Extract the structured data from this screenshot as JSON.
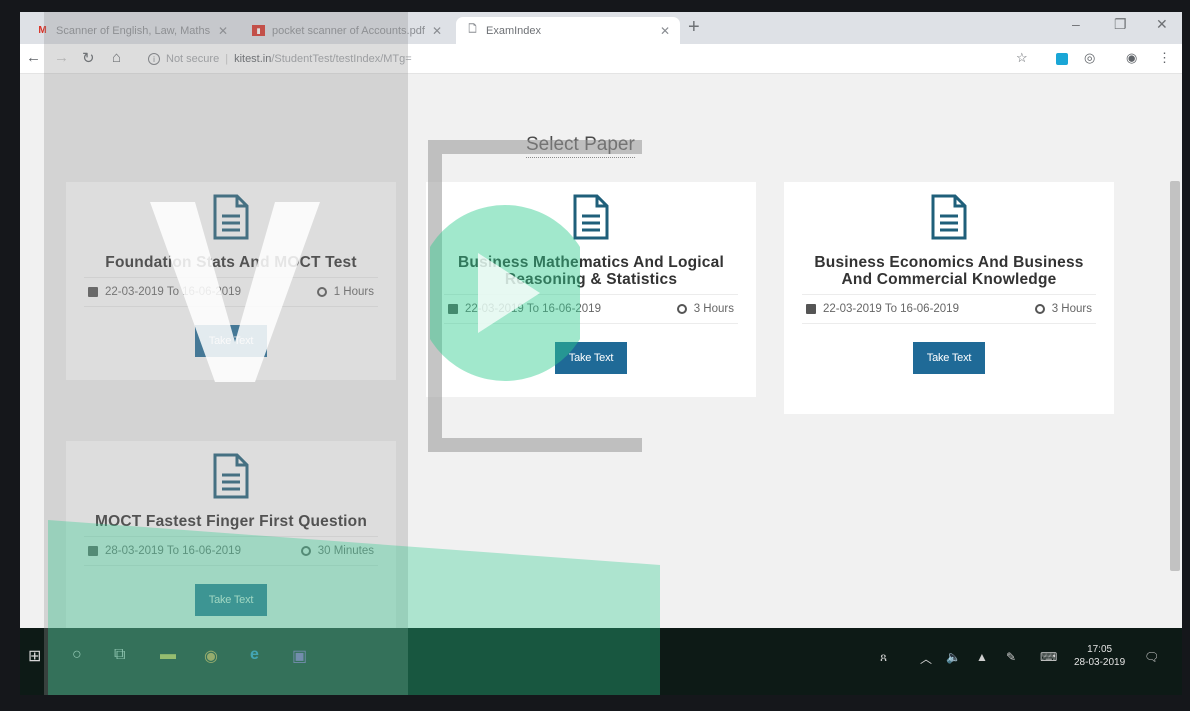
{
  "browser": {
    "tabs": [
      {
        "title": "Scanner of English, Law, Maths",
        "icon": "gmail-icon",
        "active": false
      },
      {
        "title": "pocket scanner of Accounts.pdf",
        "icon": "pdf-icon",
        "active": false
      },
      {
        "title": "ExamIndex",
        "icon": "page-icon",
        "active": true
      }
    ],
    "security_label": "Not secure",
    "url_host": "kitest.in",
    "url_path": "/StudentTest/testIndex/MTg="
  },
  "page": {
    "title": "Select Paper",
    "cards": [
      {
        "title": "Foundation Stats And MOCT Test",
        "dates": "22-03-2019 To 16-06-2019",
        "duration": "1 Hours",
        "button": "Take Text"
      },
      {
        "title": "Business Mathematics And Logical Reasoning & Statistics",
        "dates": "22-03-2019 To 16-06-2019",
        "duration": "3 Hours",
        "button": "Take Text"
      },
      {
        "title": "Business Economics And Business And Commercial Knowledge",
        "dates": "22-03-2019 To 16-06-2019",
        "duration": "3 Hours",
        "button": "Take Text"
      },
      {
        "title": "MOCT Fastest Finger First Question",
        "dates": "28-03-2019 To 16-06-2019",
        "duration": "30 Minutes",
        "button": "Take Text"
      }
    ]
  },
  "taskbar": {
    "time": "17:05",
    "date": "28-03-2019"
  },
  "colors": {
    "accent_button": "#1f6a97",
    "doc_icon": "#1f5f7a",
    "watermark_green": "#2ecc8f"
  }
}
